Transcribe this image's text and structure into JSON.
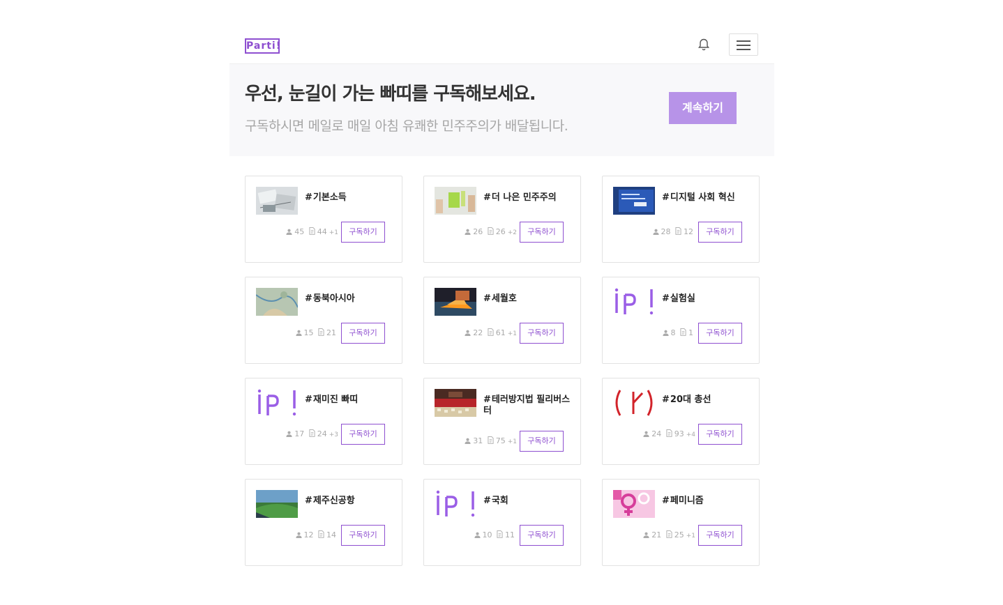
{
  "header": {
    "logo": "Parti!",
    "bell_icon": "bell-icon",
    "menu_icon": "hamburger-icon"
  },
  "hero": {
    "title": "우선, 눈길이 가는 빠띠를 구독해보세요.",
    "subtitle": "구독하시면 메일로 매일 아침 유쾌한 민주주의가 배달됩니다.",
    "cta": "계속하기",
    "cta_color": "#b793e8"
  },
  "accent": "#8e4fd0",
  "cards": [
    {
      "hash": "#",
      "name": "기본소득",
      "members": "45",
      "posts": "44",
      "extra": "+1",
      "button": "구독하기"
    },
    {
      "hash": "#",
      "name": "더 나은 민주주의",
      "members": "26",
      "posts": "26",
      "extra": "+2",
      "button": "구독하기"
    },
    {
      "hash": "#",
      "name": "디지털 사회 혁신",
      "members": "28",
      "posts": "12",
      "extra": "",
      "button": "구독하기"
    },
    {
      "hash": "#",
      "name": "동북아시아",
      "members": "15",
      "posts": "21",
      "extra": "",
      "button": "구독하기"
    },
    {
      "hash": "#",
      "name": "세월호",
      "members": "22",
      "posts": "61",
      "extra": "+1",
      "button": "구독하기"
    },
    {
      "hash": "#",
      "name": "실험실",
      "members": "8",
      "posts": "1",
      "extra": "",
      "button": "구독하기"
    },
    {
      "hash": "#",
      "name": "재미진 빠띠",
      "members": "17",
      "posts": "24",
      "extra": "+3",
      "button": "구독하기"
    },
    {
      "hash": "#",
      "name": "테러방지법 필리버스터",
      "members": "31",
      "posts": "75",
      "extra": "+1",
      "button": "구독하기"
    },
    {
      "hash": "#",
      "name": "20대 총선",
      "members": "24",
      "posts": "93",
      "extra": "+4",
      "button": "구독하기"
    },
    {
      "hash": "#",
      "name": "제주신공항",
      "members": "12",
      "posts": "14",
      "extra": "",
      "button": "구독하기"
    },
    {
      "hash": "#",
      "name": "국회",
      "members": "10",
      "posts": "11",
      "extra": "",
      "button": "구독하기"
    },
    {
      "hash": "#",
      "name": "페미니즘",
      "members": "21",
      "posts": "25",
      "extra": "+1",
      "button": "구독하기"
    }
  ]
}
